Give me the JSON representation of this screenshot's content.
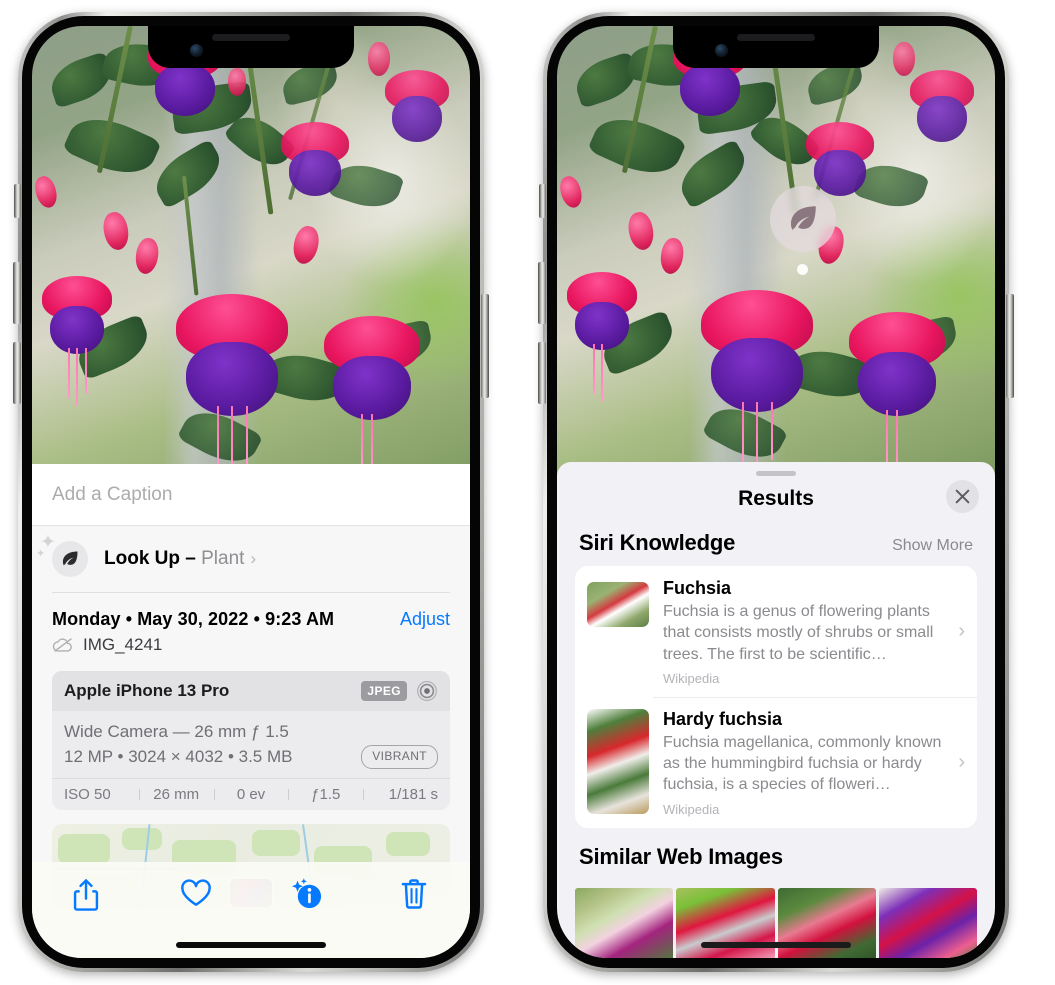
{
  "left_phone": {
    "photo": {
      "alt": "fuchsia-flowers-photo"
    },
    "caption_field": {
      "placeholder": "Add a Caption",
      "value": ""
    },
    "lookup": {
      "label": "Look Up – ",
      "subject": "Plant",
      "icon": "leaf-icon",
      "chevron": "›"
    },
    "datetime": "Monday • May 30, 2022 • 9:23 AM",
    "adjust_label": "Adjust",
    "filename": "IMG_4241",
    "cloud_icon": "icloud-slash-icon",
    "metadata": {
      "model": "Apple iPhone 13 Pro",
      "format_badge": "JPEG",
      "lens_icon": "camera-lens-icon",
      "lens_line": "Wide Camera — 26 mm ƒ 1.5",
      "size_line": "12 MP • 3024 × 4032 • 3.5 MB",
      "style_badge": "VIBRANT",
      "exif": [
        "ISO 50",
        "26 mm",
        "0 ev",
        "ƒ1.5",
        "1/181 s"
      ]
    },
    "map": {
      "name": "photo-location-map",
      "pin": "photo-pin"
    },
    "toolbar": [
      {
        "name": "share-button",
        "icon": "share-icon"
      },
      {
        "name": "favorite-button",
        "icon": "heart-icon"
      },
      {
        "name": "info-button",
        "icon": "info-sparkle-icon"
      },
      {
        "name": "delete-button",
        "icon": "trash-icon"
      }
    ],
    "accent_color": "#067aff"
  },
  "right_phone": {
    "visual_lookup_badge": {
      "icon": "leaf-icon",
      "name": "visual-lookup-badge"
    },
    "sheet": {
      "title": "Results",
      "close_label": "✕",
      "sections": [
        {
          "heading": "Siri Knowledge",
          "action": "Show More",
          "items": [
            {
              "title": "Fuchsia",
              "description": "Fuchsia is a genus of flowering plants that consists mostly of shrubs or small trees. The first to be scientific…",
              "source": "Wikipedia",
              "thumb": "fuchsia-thumbnail"
            },
            {
              "title": "Hardy fuchsia",
              "description": "Fuchsia magellanica, commonly known as the hummingbird fuchsia or hardy fuchsia, is a species of floweri…",
              "source": "Wikipedia",
              "thumb": "hardy-fuchsia-thumbnail"
            }
          ]
        },
        {
          "heading": "Similar Web Images",
          "images": [
            "web-image-1",
            "web-image-2",
            "web-image-3",
            "web-image-4"
          ]
        }
      ]
    }
  }
}
